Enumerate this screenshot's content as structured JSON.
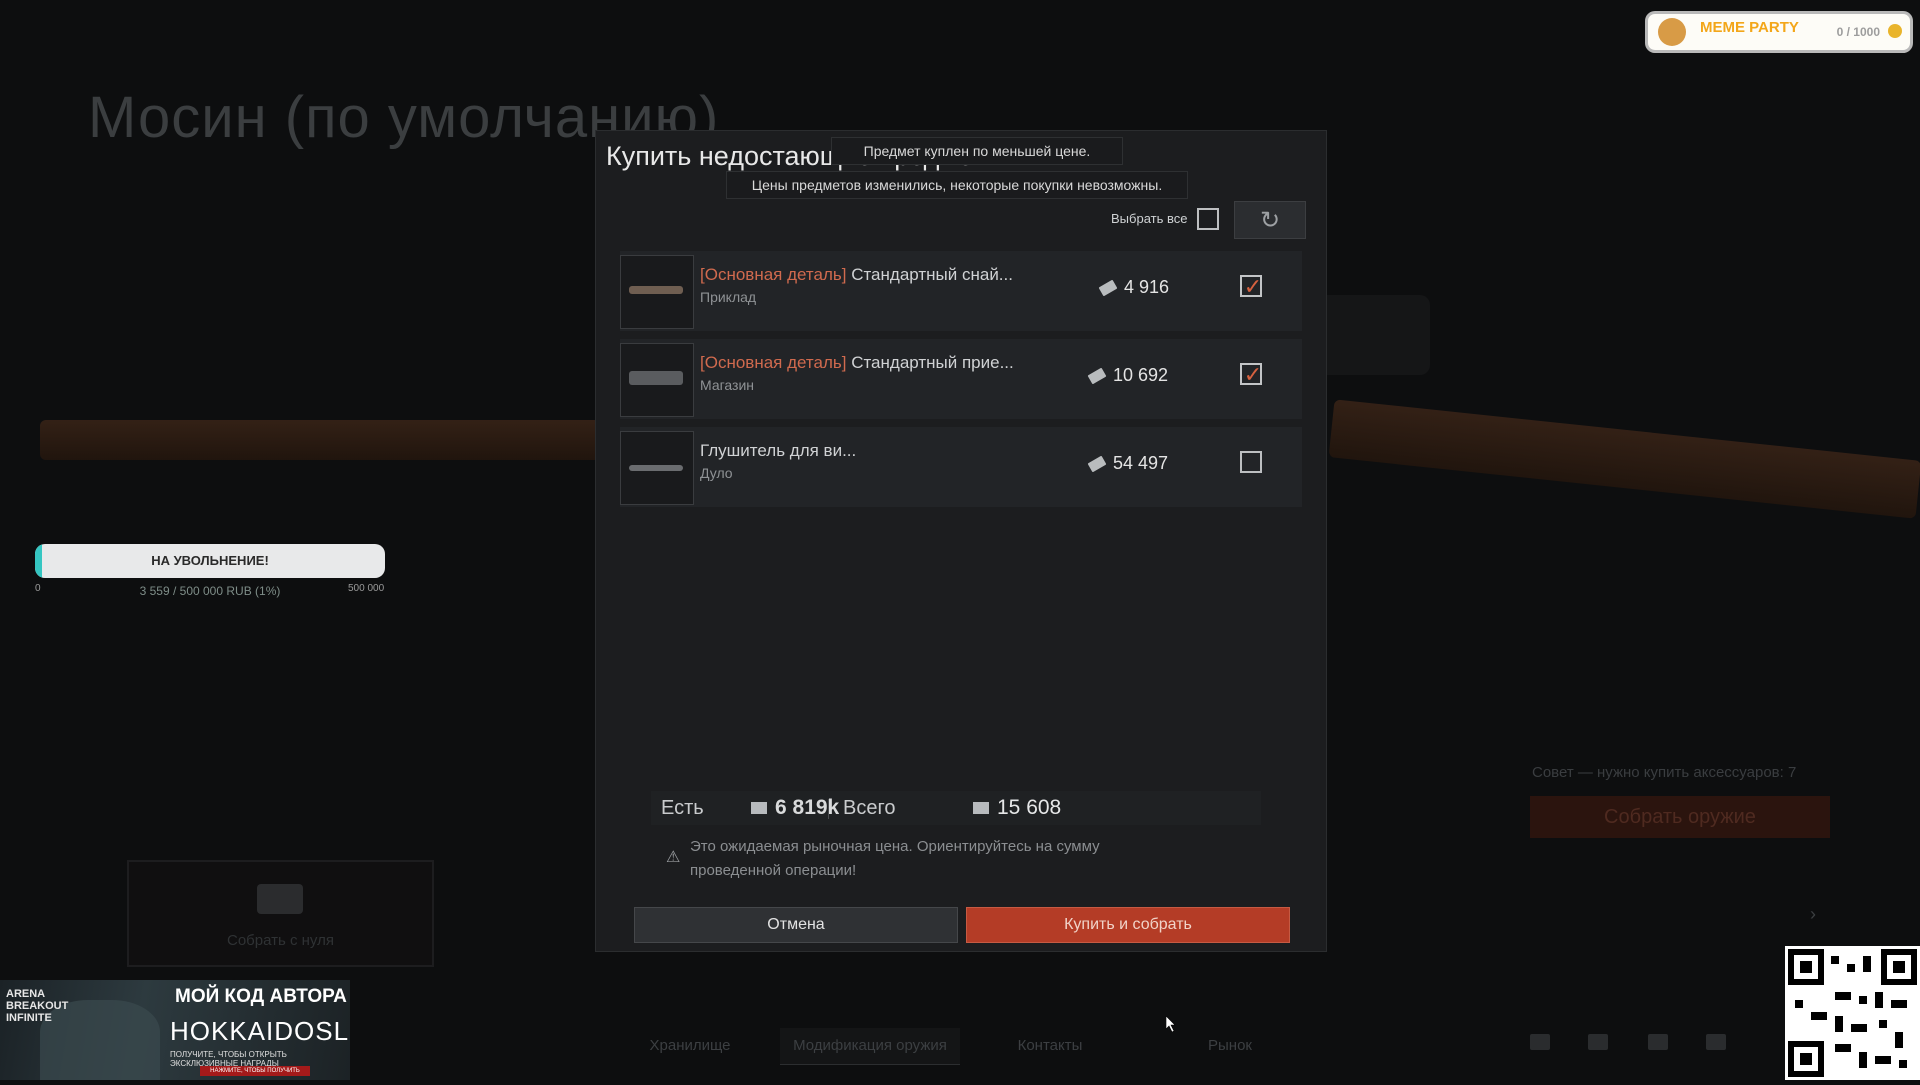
{
  "background": {
    "weapon_title": "Мосин (по умолчанию)",
    "tip": "Совет — нужно купить аксессуаров: 7",
    "assemble_button": "Собрать оружие",
    "build_from_scratch": "Собрать с нуля",
    "nav": {
      "storage": "Хранилище",
      "weapon_mod": "Модификация оружия",
      "contacts": "Контакты",
      "market": "Рынок"
    }
  },
  "progress_widget": {
    "label": "НА УВОЛЬНЕНИЕ!",
    "min": "0",
    "max": "500 000",
    "value_text": "3 559 / 500 000 RUB (1%)",
    "fraction": 0.01,
    "accent": "#35c6c2"
  },
  "overlay": {
    "meme_title": "MEME PARTY",
    "meme_count": "0 / 1000",
    "promo_logo": "ARENA BREAKOUT INFINITE",
    "promo_headline": "МОЙ КОД АВТОРА",
    "promo_code": "HOKKAIDOSL",
    "promo_sub": "ПОЛУЧИТЕ, ЧТОБЫ ОТКРЫТЬ ЭКСКЛЮЗИВНЫЕ НАГРАДЫ",
    "promo_btn": "НАЖМИТЕ, ЧТОБЫ ПОЛУЧИТЬ"
  },
  "modal": {
    "title": "Купить недостающие предметы",
    "tooltip_price": "Предмет куплен по меньшей цене.",
    "tooltip_changed": "Цены предметов изменились, некоторые покупки невозможны.",
    "select_all": "Выбрать все",
    "refresh_icon": "refresh-icon",
    "items": [
      {
        "tag": "[Основная деталь]",
        "name": "Стандартный снай...",
        "slot": "Приклад",
        "price": "4 916",
        "checked": true
      },
      {
        "tag": "[Основная деталь]",
        "name": "Стандартный прие...",
        "slot": "Магазин",
        "price": "10 692",
        "checked": true
      },
      {
        "tag": "",
        "name": "Глушитель для ви...",
        "slot": "Дуло",
        "price": "54 497",
        "checked": false
      }
    ],
    "have_label": "Есть",
    "have_value": "6 819k",
    "total_label": "Всего",
    "total_value": "15 608",
    "notice": "Это ожидаемая рыночная цена. Ориентируйтесь на сумму проведенной операции!",
    "cancel": "Отмена",
    "buy": "Купить и собрать",
    "accent": "#b43c26"
  }
}
